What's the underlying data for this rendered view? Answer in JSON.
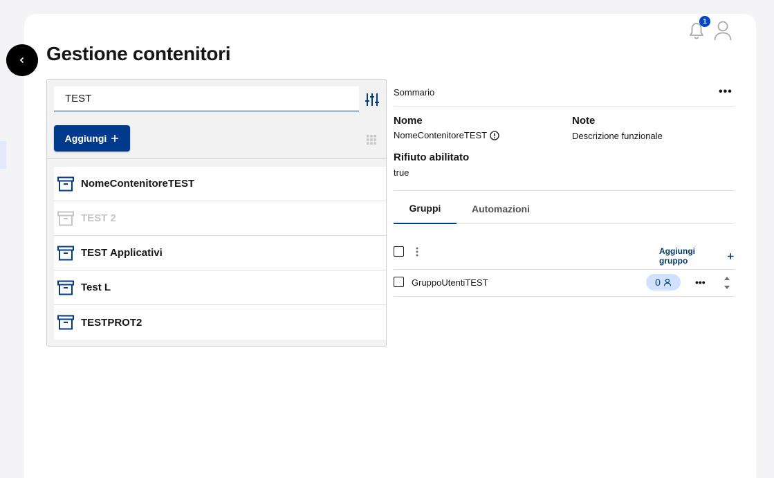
{
  "page": {
    "title": "Gestione contenitori"
  },
  "header": {
    "notification_count": "1"
  },
  "left_panel": {
    "search_value": "TEST",
    "add_button_label": "Aggiungi",
    "items": [
      {
        "label": "NomeContenitoreTEST",
        "disabled": false
      },
      {
        "label": "TEST 2",
        "disabled": true
      },
      {
        "label": "TEST Applicativi",
        "disabled": false
      },
      {
        "label": "Test L",
        "disabled": false
      },
      {
        "label": "TESTPROT2",
        "disabled": false
      }
    ]
  },
  "summary": {
    "label": "Sommario",
    "nome_label": "Nome",
    "nome_value": "NomeContenitoreTEST",
    "note_label": "Note",
    "note_value": "Descrizione funzionale",
    "rifiuto_label": "Rifiuto abilitato",
    "rifiuto_value": "true"
  },
  "tabs": [
    {
      "label": "Gruppi",
      "active": true
    },
    {
      "label": "Automazioni",
      "active": false
    }
  ],
  "groups": {
    "add_label": "Aggiungi gruppo",
    "rows": [
      {
        "name": "GruppoUtentiTEST",
        "count": "0"
      }
    ]
  },
  "colors": {
    "primary": "#003a8c",
    "badge": "#0043ce",
    "pill": "#d0e2ff"
  }
}
